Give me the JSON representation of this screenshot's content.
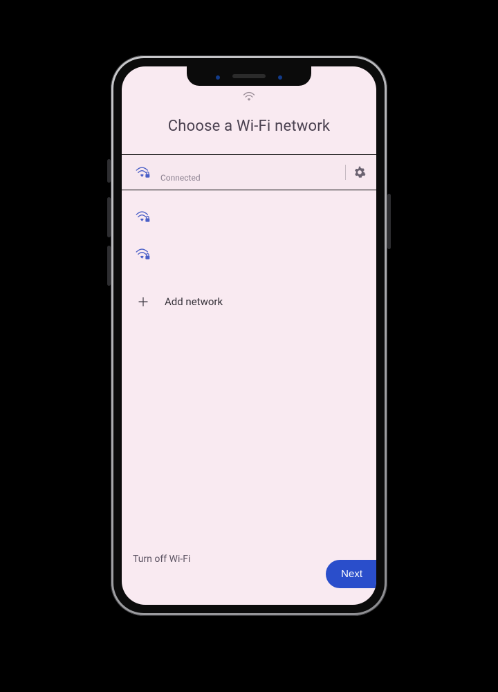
{
  "header": {
    "title": "Choose a Wi-Fi network"
  },
  "status": {
    "wifi_icon": "wifi"
  },
  "networks": [
    {
      "name": "",
      "status": "Connected",
      "secured": true,
      "selected": true
    },
    {
      "name": "",
      "status": "",
      "secured": true,
      "selected": false
    },
    {
      "name": "",
      "status": "",
      "secured": true,
      "selected": false
    }
  ],
  "add_network": {
    "label": "Add network"
  },
  "footer": {
    "turn_off_label": "Turn off Wi-Fi",
    "next_label": "Next"
  },
  "colors": {
    "accent": "#2a4ecb",
    "screen_bg": "#f9eaf1",
    "wifi_icon": "#4a5fc7"
  }
}
